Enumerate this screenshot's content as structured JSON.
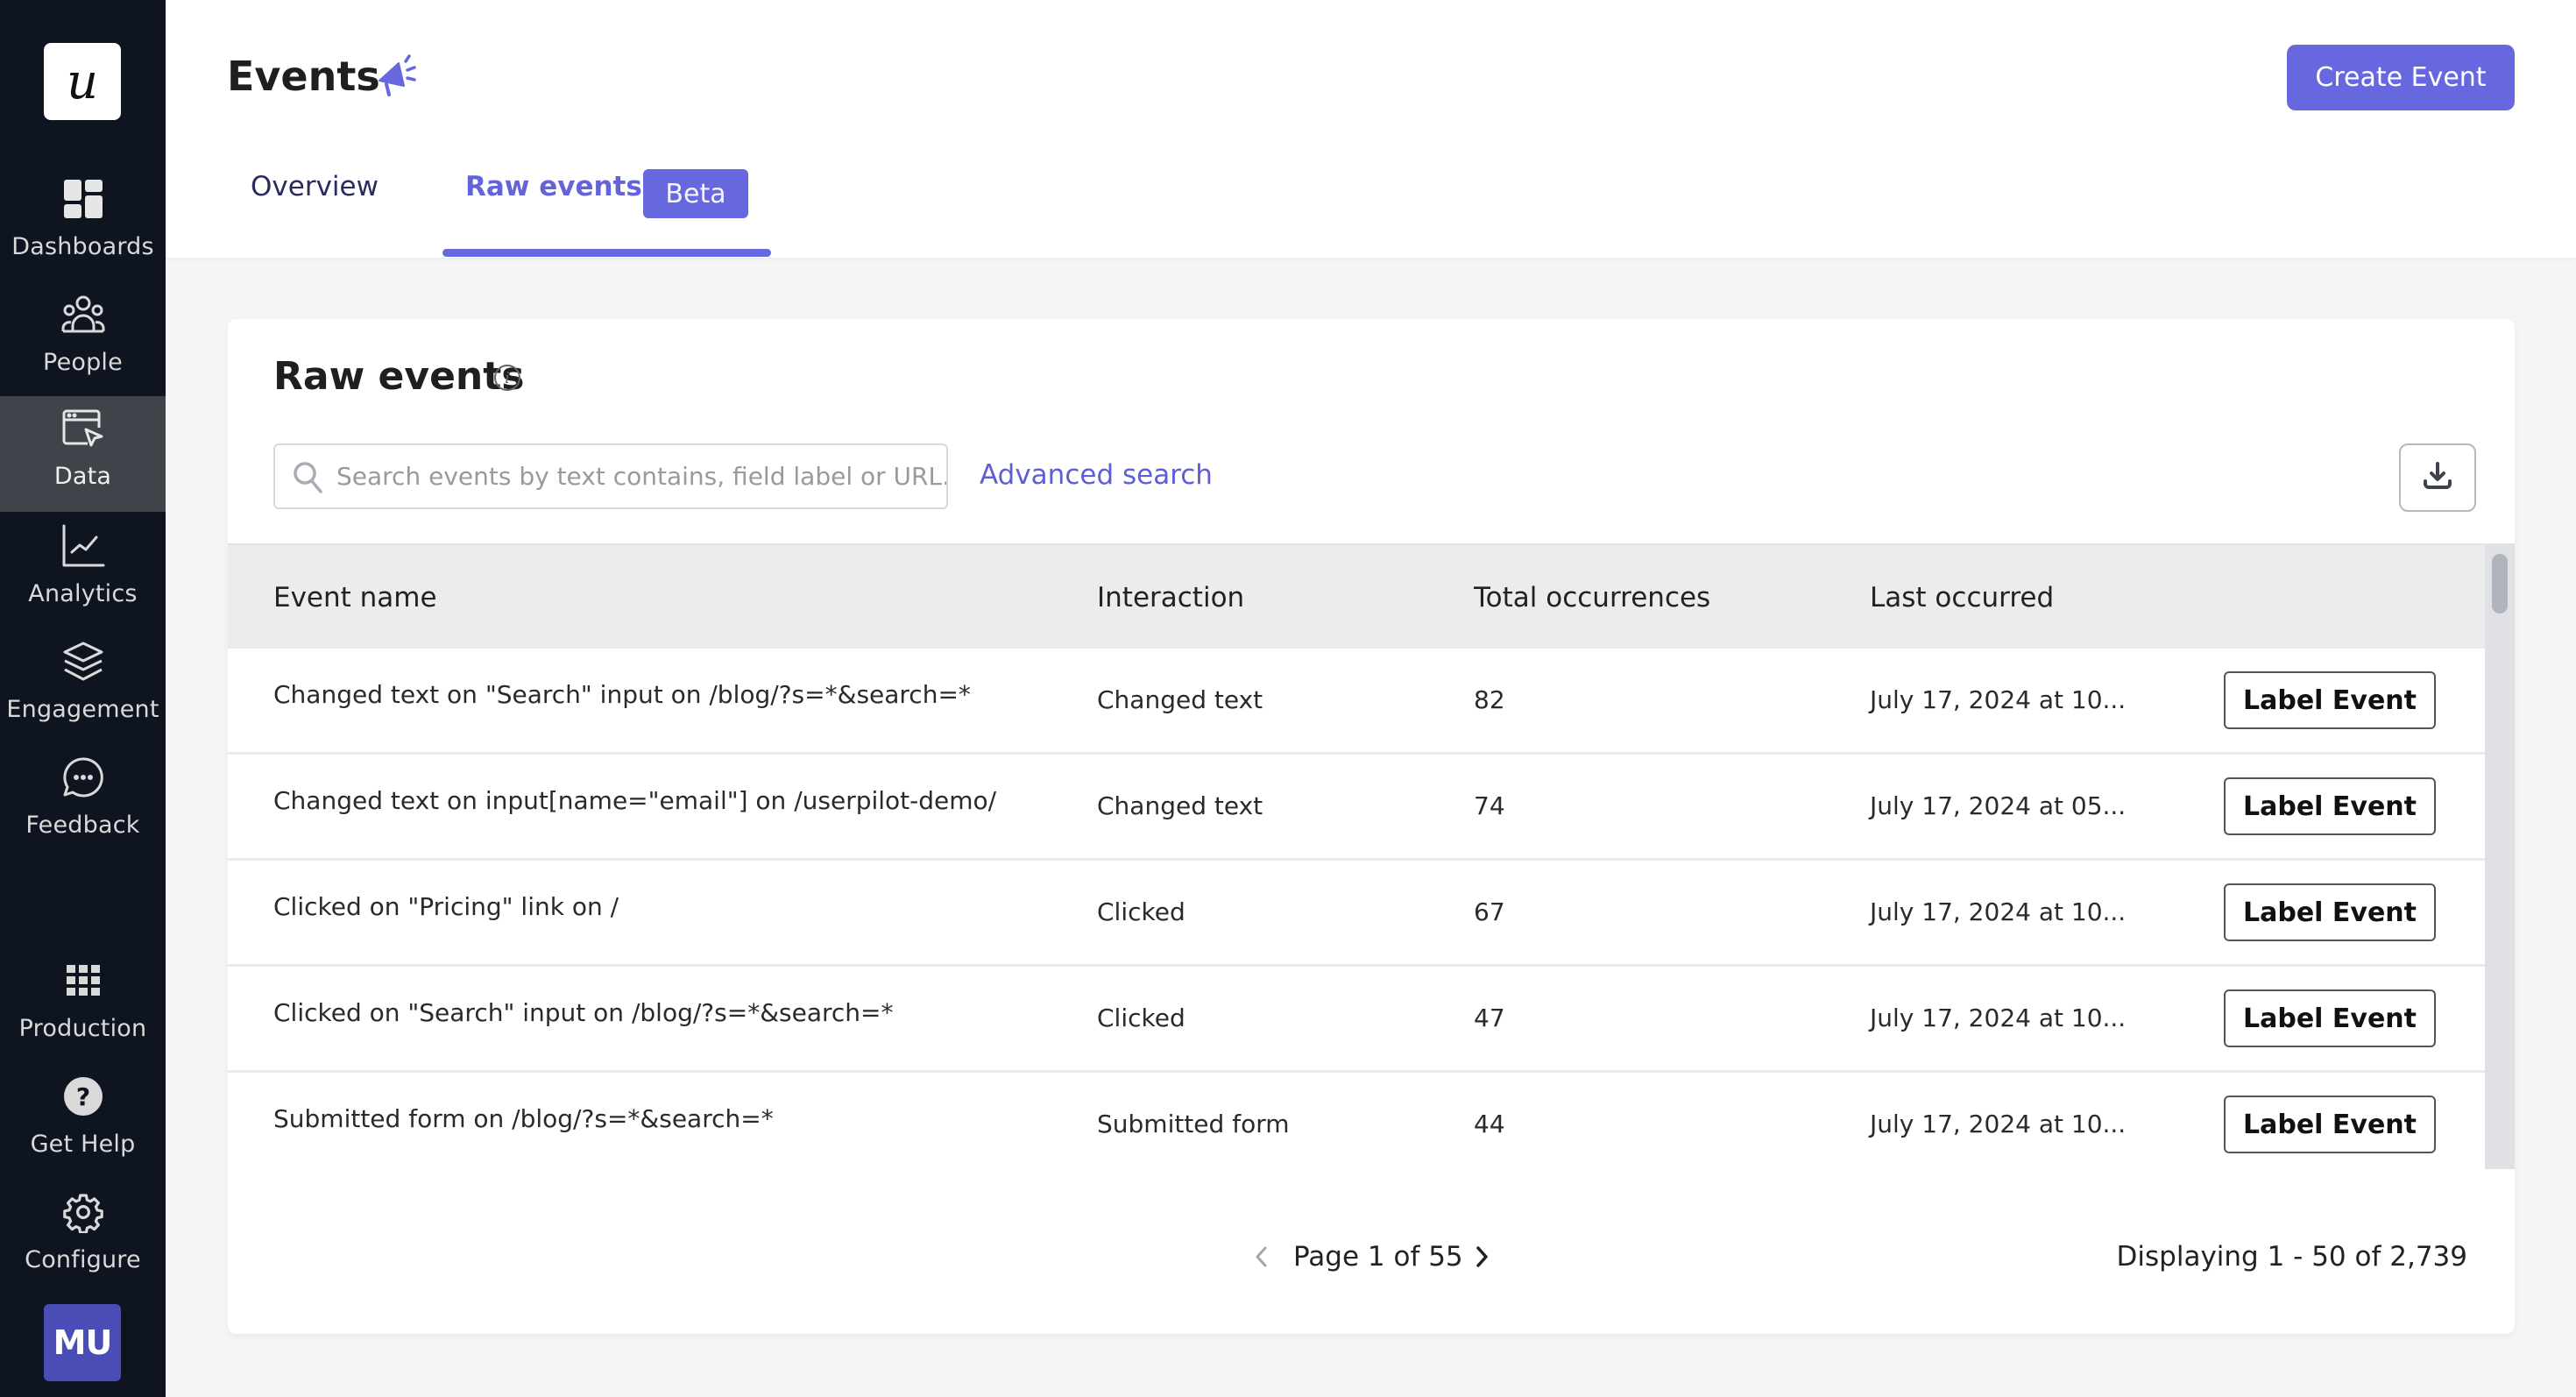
{
  "sidebar": {
    "logo": "u",
    "items": [
      {
        "label": "Dashboards",
        "icon": "dashboard-icon",
        "active": false
      },
      {
        "label": "People",
        "icon": "people-icon",
        "active": false
      },
      {
        "label": "Data",
        "icon": "data-icon",
        "active": true
      },
      {
        "label": "Analytics",
        "icon": "analytics-icon",
        "active": false
      },
      {
        "label": "Engagement",
        "icon": "layers-icon",
        "active": false
      },
      {
        "label": "Feedback",
        "icon": "chat-bubble-icon",
        "active": false
      },
      {
        "label": "Production",
        "icon": "grid-icon",
        "active": false
      },
      {
        "label": "Get Help",
        "icon": "help-icon",
        "active": false
      },
      {
        "label": "Configure",
        "icon": "gear-icon",
        "active": false
      }
    ],
    "avatar": "MU"
  },
  "header": {
    "title": "Events",
    "title_icon": "megaphone-icon",
    "create_button": "Create Event",
    "tabs": [
      {
        "label": "Overview",
        "active": false
      },
      {
        "label": "Raw events",
        "active": true,
        "badge": "Beta"
      }
    ]
  },
  "colors": {
    "accent": "#6767e0",
    "sidebar_bg": "#0f1520",
    "sidebar_active": "#40444a",
    "avatar_bg": "#4a4db5"
  },
  "card": {
    "title": "Raw events",
    "search": {
      "placeholder": "Search events by text contains, field label or URL...",
      "value": ""
    },
    "advanced_search": "Advanced search",
    "table": {
      "columns": [
        "Event name",
        "Interaction",
        "Total occurrences",
        "Last occurred"
      ],
      "rows": [
        {
          "name": "Changed text on \"Search\" input on /blog/?s=*&search=*",
          "interaction": "Changed text",
          "total": "82",
          "last": "July 17, 2024 at 10...",
          "action": "Label Event"
        },
        {
          "name": "Changed text on input[name=\"email\"] on /userpilot-demo/",
          "interaction": "Changed text",
          "total": "74",
          "last": "July 17, 2024 at 05...",
          "action": "Label Event"
        },
        {
          "name": "Clicked on \"Pricing\" link on /",
          "interaction": "Clicked",
          "total": "67",
          "last": "July 17, 2024 at 10...",
          "action": "Label Event"
        },
        {
          "name": "Clicked on \"Search\" input on /blog/?s=*&search=*",
          "interaction": "Clicked",
          "total": "47",
          "last": "July 17, 2024 at 10...",
          "action": "Label Event"
        },
        {
          "name": "Submitted form on /blog/?s=*&search=*",
          "interaction": "Submitted form",
          "total": "44",
          "last": "July 17, 2024 at 10...",
          "action": "Label Event"
        }
      ]
    },
    "pagination": {
      "page_text": "Page 1 of 55",
      "current_page": 1,
      "total_pages": 55,
      "display_text": "Displaying 1 - 50 of 2,739"
    }
  }
}
